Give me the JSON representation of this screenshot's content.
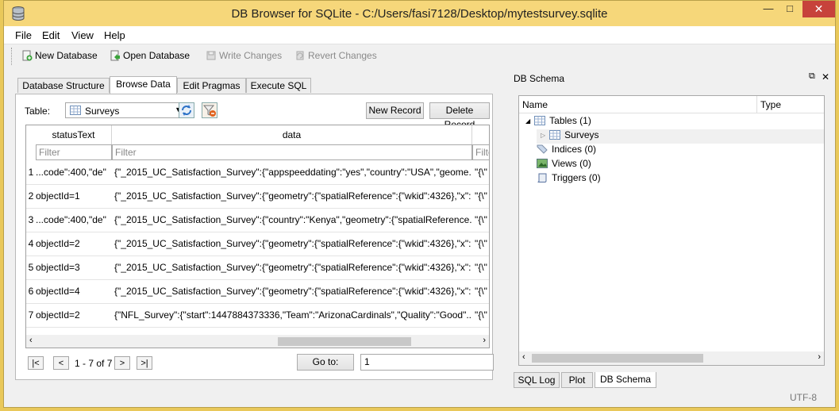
{
  "window": {
    "title": "DB Browser for SQLite - C:/Users/fasi7128/Desktop/mytestsurvey.sqlite",
    "min": "—",
    "max": "□",
    "close": "✕"
  },
  "menu": [
    "File",
    "Edit",
    "View",
    "Help"
  ],
  "toolbar": {
    "new_db": "New Database",
    "open_db": "Open Database",
    "write": "Write Changes",
    "revert": "Revert Changes"
  },
  "tabs": [
    "Database Structure",
    "Browse Data",
    "Edit Pragmas",
    "Execute SQL"
  ],
  "browse": {
    "table_label": "Table:",
    "table_value": "Surveys",
    "new_record": "New Record",
    "delete_record": "Delete Record",
    "columns": [
      "statusText",
      "data"
    ],
    "filter_placeholder": "Filter",
    "filter_partial": "Filte",
    "rows": [
      {
        "n": "1",
        "status": "\"code\":400,\"de...",
        "data": "{\"_2015_UC_Satisfaction_Survey\":{\"appspeeddating\":\"yes\",\"country\":\"USA\",\"geome...",
        "extra": "\"{\\\""
      },
      {
        "n": "2",
        "status": "objectId=1",
        "data": "{\"_2015_UC_Satisfaction_Survey\":{\"geometry\":{\"spatialReference\":{\"wkid\":4326},\"x\":...",
        "extra": "\"{\\\""
      },
      {
        "n": "3",
        "status": "\"code\":400,\"de...",
        "data": "{\"_2015_UC_Satisfaction_Survey\":{\"country\":\"Kenya\",\"geometry\":{\"spatialReference...",
        "extra": "\"{\\\""
      },
      {
        "n": "4",
        "status": "objectId=2",
        "data": "{\"_2015_UC_Satisfaction_Survey\":{\"geometry\":{\"spatialReference\":{\"wkid\":4326},\"x\":...",
        "extra": "\"{\\\""
      },
      {
        "n": "5",
        "status": "objectId=3",
        "data": "{\"_2015_UC_Satisfaction_Survey\":{\"geometry\":{\"spatialReference\":{\"wkid\":4326},\"x\":...",
        "extra": "\"{\\\""
      },
      {
        "n": "6",
        "status": "objectId=4",
        "data": "{\"_2015_UC_Satisfaction_Survey\":{\"geometry\":{\"spatialReference\":{\"wkid\":4326},\"x\":...",
        "extra": "\"{\\\""
      },
      {
        "n": "7",
        "status": "objectId=2",
        "data": "{\"NFL_Survey\":{\"start\":1447884373336,\"Team\":\"ArizonaCardinals\",\"Quality\":\"Good\"...",
        "extra": "\"{\\\""
      }
    ],
    "nav_first": "|<",
    "nav_prev": "<",
    "nav_count": "1 - 7 of 7",
    "nav_next": ">",
    "nav_last": ">|",
    "goto_label": "Go to:",
    "goto_value": "1"
  },
  "schema": {
    "title": "DB Schema",
    "float_icon": "⧉",
    "close_icon": "✕",
    "col_name": "Name",
    "col_type": "Type",
    "items": {
      "tables": "Tables (1)",
      "surveys": "Surveys",
      "indices": "Indices (0)",
      "views": "Views (0)",
      "triggers": "Triggers (0)"
    }
  },
  "bottom_tabs": [
    "SQL Log",
    "Plot",
    "DB Schema"
  ],
  "status": {
    "encoding": "UTF-8"
  }
}
